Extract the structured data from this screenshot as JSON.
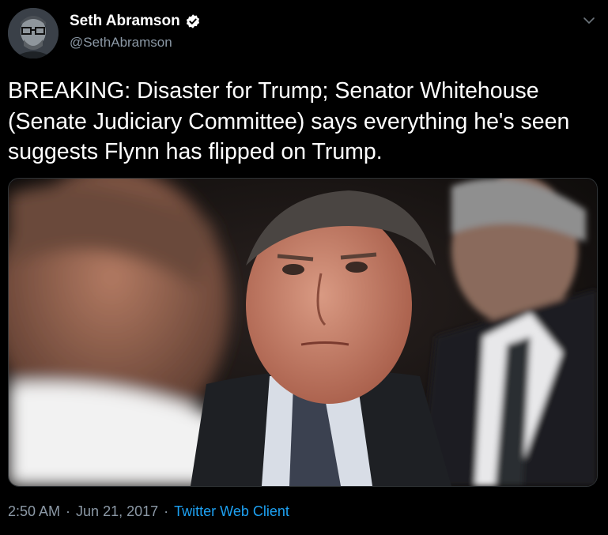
{
  "author": {
    "display_name": "Seth Abramson",
    "handle": "@SethAbramson",
    "verified": true
  },
  "tweet": {
    "text": "BREAKING: Disaster for Trump; Senator Whitehouse (Senate Judiciary Committee) says everything he's seen suggests Flynn has flipped on Trump.",
    "time": "2:50 AM",
    "date": "Jun 21, 2017",
    "separator": "·",
    "client": "Twitter Web Client"
  },
  "icons": {
    "verified": "verified-badge-icon",
    "more": "chevron-down-icon"
  },
  "colors": {
    "background": "#000000",
    "link": "#1da1f2",
    "muted": "#8b98a5",
    "text": "#ffffff"
  }
}
